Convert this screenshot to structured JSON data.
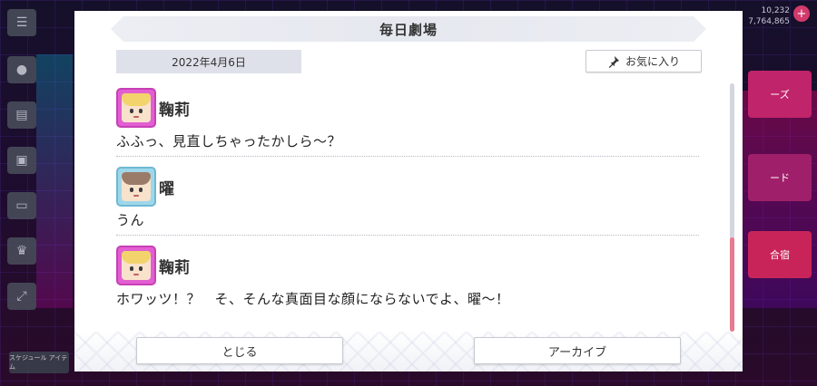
{
  "background": {
    "stats": [
      "10,232",
      "7,764,865"
    ],
    "side_buttons": [
      "menu-icon",
      "chat-icon",
      "shop-icon",
      "gift-icon",
      "card-icon",
      "trophy-icon",
      "expand-icon"
    ],
    "right_tiles": [
      "ーズ",
      "ード",
      "合宿"
    ],
    "bottom_chip": "スケジュール アイテム"
  },
  "modal": {
    "title": "毎日劇場",
    "date": "2022年4月6日",
    "favorite_label": "お気に入り",
    "entries": [
      {
        "speaker": "鞠莉",
        "avatar": "pink",
        "text": "ふふっ、見直しちゃったかしら～？"
      },
      {
        "speaker": "曜",
        "avatar": "blue",
        "text": "うん"
      },
      {
        "speaker": "鞠莉",
        "avatar": "pink",
        "text": "ホワッツ！？　そ、そんな真面目な顔にならないでよ、曜～！"
      }
    ],
    "close_label": "とじる",
    "archive_label": "アーカイブ"
  },
  "colors": {
    "accent_scroll": "#e87a8f",
    "avatar_pink": "#e25fd1",
    "avatar_blue": "#9fd7ea",
    "date_badge_bg": "#dfe1ea"
  }
}
